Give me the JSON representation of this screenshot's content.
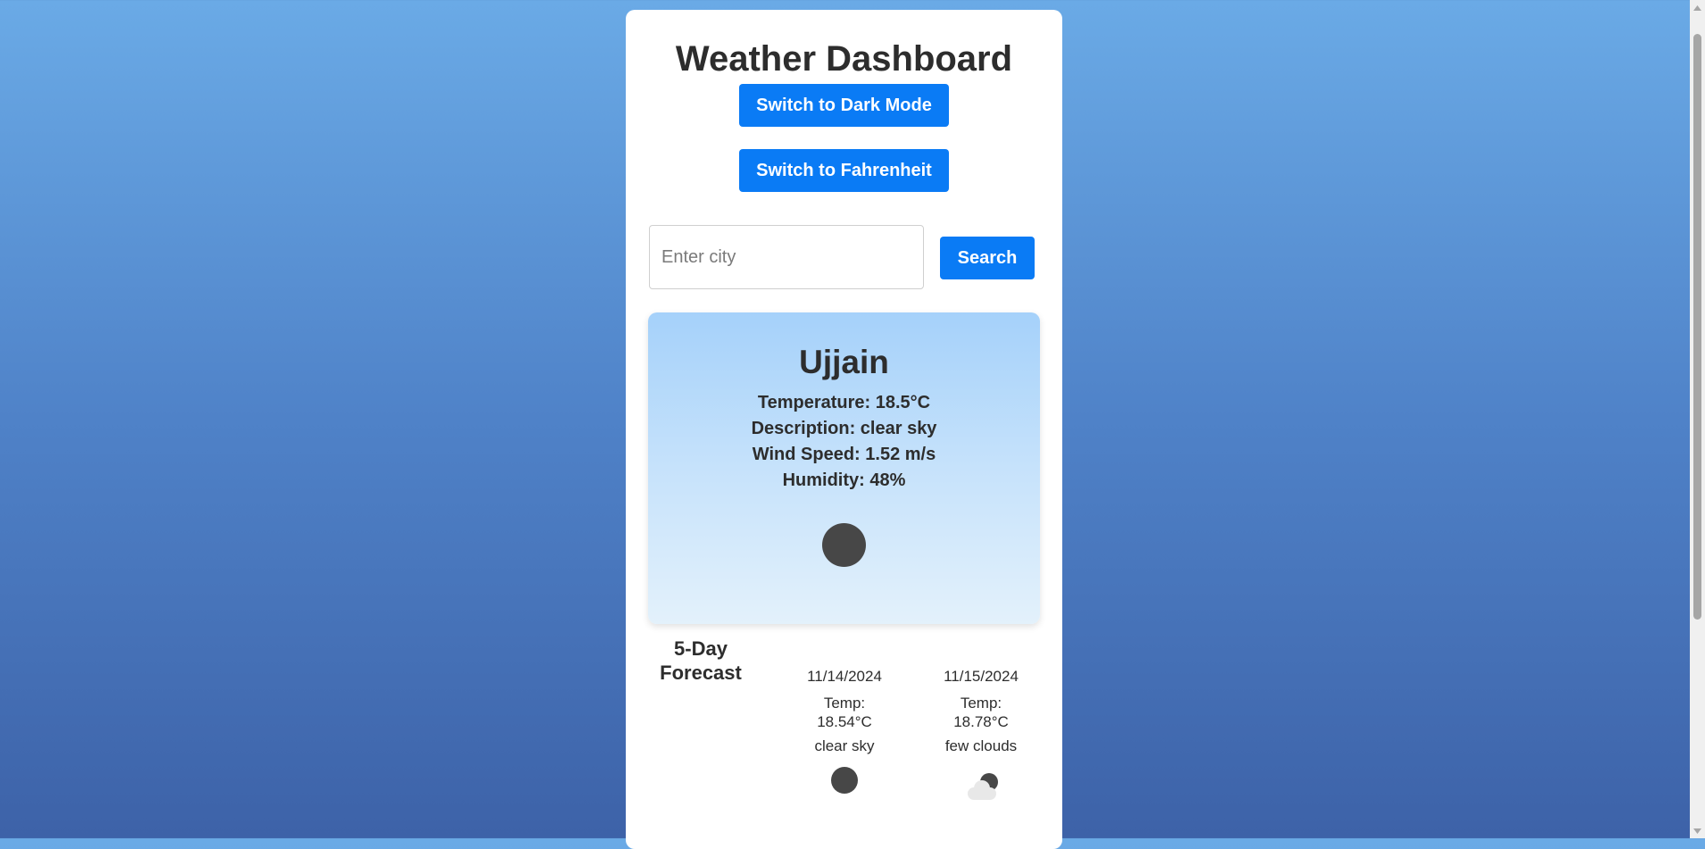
{
  "header": {
    "title": "Weather Dashboard",
    "dark_mode_label": "Switch to Dark Mode",
    "unit_toggle_label": "Switch to Fahrenheit"
  },
  "search": {
    "placeholder": "Enter city",
    "value": "",
    "button_label": "Search"
  },
  "current": {
    "city": "Ujjain",
    "temperature": "Temperature: 18.5°C",
    "description": "Description: clear sky",
    "wind_speed": "Wind Speed: 1.52 m/s",
    "humidity": "Humidity: 48%",
    "icon": "sun-icon"
  },
  "forecast": {
    "heading": "5-Day Forecast",
    "days": [
      {
        "date": "11/14/2024",
        "temp_label": "Temp:",
        "temp_value": "18.54°C",
        "description": "clear sky",
        "icon": "sun-icon"
      },
      {
        "date": "11/15/2024",
        "temp_label": "Temp:",
        "temp_value": "18.78°C",
        "description": "few clouds",
        "icon": "cloud-sun-icon"
      }
    ]
  },
  "colors": {
    "accent": "#0a7bf5",
    "background_top": "#6aaae6",
    "background_bottom": "#3d62a8",
    "card": "#ffffff",
    "current_panel_top": "#a5d1fa",
    "current_panel_bottom": "#e3f1fb",
    "icon_dark": "#474747"
  }
}
